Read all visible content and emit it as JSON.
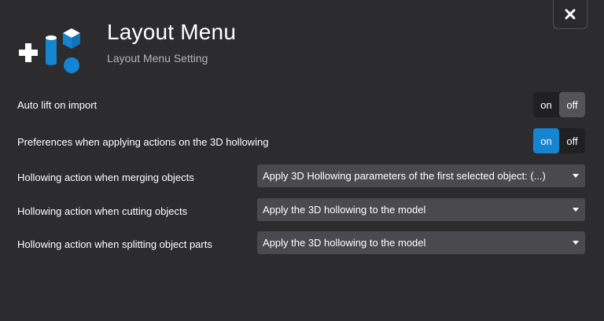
{
  "header": {
    "title": "Layout Menu",
    "subtitle": "Layout Menu Setting",
    "logo_icon": "layout-shapes-icon",
    "close_icon": "close-icon"
  },
  "colors": {
    "background": "#2c2c2f",
    "accent": "#1584d1",
    "dropdown": "#4a4a4e"
  },
  "settings": {
    "auto_lift": {
      "label": "Auto lift on import",
      "on_label": "on",
      "off_label": "off",
      "value": "off"
    },
    "hollow_prefs": {
      "label": "Preferences when applying actions on the 3D hollowing",
      "on_label": "on",
      "off_label": "off",
      "value": "on"
    },
    "merge": {
      "label": "Hollowing action when merging objects",
      "selected": "Apply 3D Hollowing parameters of the first selected object: (...)"
    },
    "cut": {
      "label": "Hollowing action when cutting objects",
      "selected": "Apply the 3D hollowing to the model"
    },
    "split": {
      "label": "Hollowing action when splitting object parts",
      "selected": "Apply the 3D hollowing to the model"
    }
  }
}
